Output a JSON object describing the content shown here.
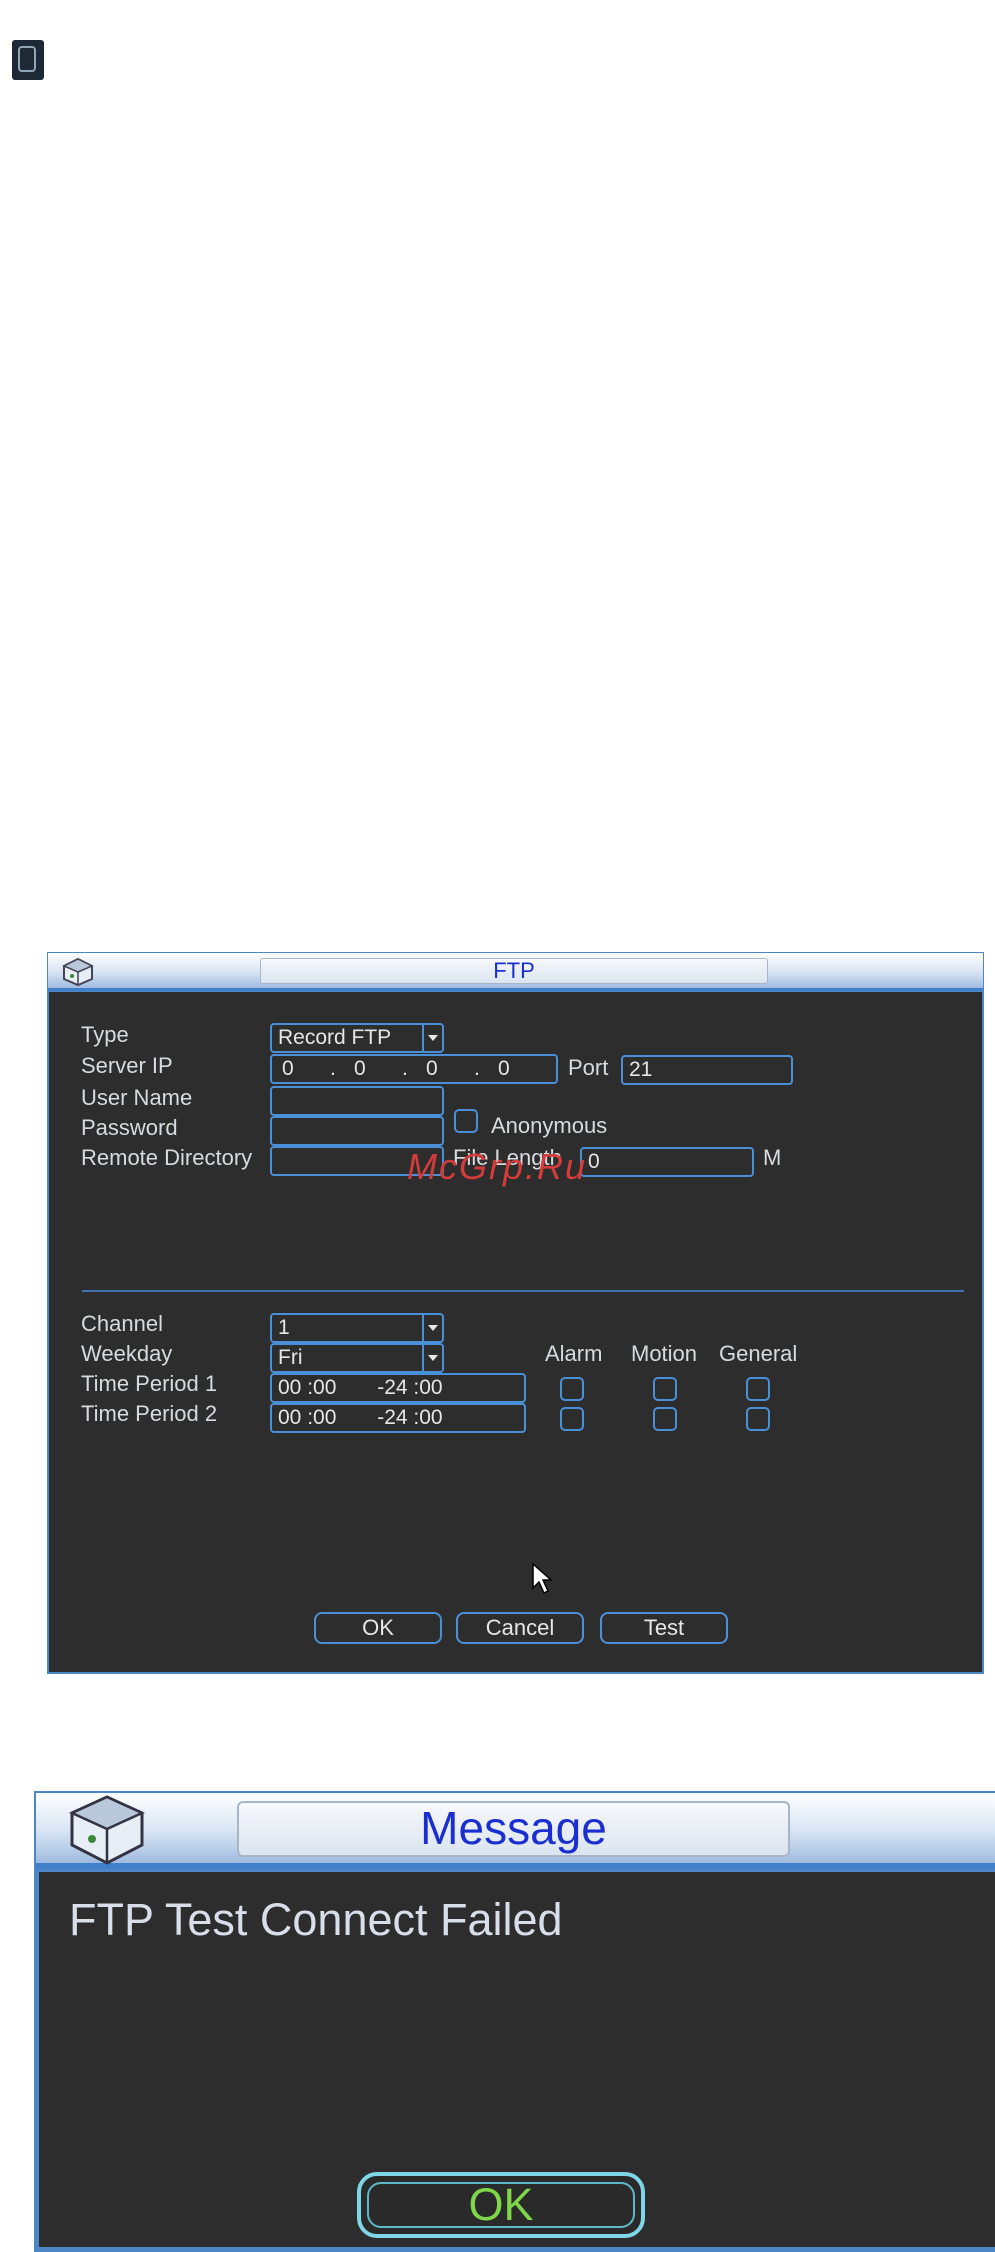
{
  "ftp": {
    "title": "FTP",
    "labels": {
      "type": "Type",
      "server_ip": "Server IP",
      "port": "Port",
      "user_name": "User Name",
      "password": "Password",
      "anonymous": "Anonymous",
      "remote_directory": "Remote Directory",
      "file_length": "File Length",
      "file_length_unit": "M",
      "channel": "Channel",
      "weekday": "Weekday",
      "alarm": "Alarm",
      "motion": "Motion",
      "general": "General",
      "time_period_1": "Time Period 1",
      "time_period_2": "Time Period 2"
    },
    "values": {
      "type": "Record FTP",
      "ip": [
        "0",
        "0",
        "0",
        "0"
      ],
      "port": "21",
      "user_name": "",
      "password": "",
      "file_length": "0",
      "channel": "1",
      "weekday": "Fri",
      "period1": "00 :00       -24 :00",
      "period2": "00 :00       -24 :00"
    },
    "buttons": {
      "ok": "OK",
      "cancel": "Cancel",
      "test": "Test"
    },
    "watermark": "McGrp.Ru"
  },
  "message": {
    "title": "Message",
    "text": "FTP Test Connect Failed",
    "ok": "OK"
  },
  "colors": {
    "panel_bg": "#2d2d2d",
    "accent_border": "#4a90d9",
    "title_text": "#1b2fd0",
    "ok_text": "#7fd64a"
  }
}
